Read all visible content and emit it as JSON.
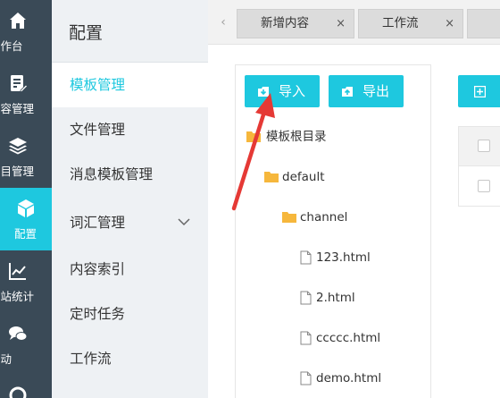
{
  "rail": {
    "items": [
      {
        "label": "工作台",
        "icon": "home-icon"
      },
      {
        "label": "内容管理",
        "icon": "document-edit-icon"
      },
      {
        "label": "栏目管理",
        "icon": "layers-icon"
      },
      {
        "label": "配置",
        "icon": "cube-icon",
        "active": true
      },
      {
        "label": "网站统计",
        "icon": "line-chart-icon"
      },
      {
        "label": "互动",
        "icon": "chat-icon"
      }
    ]
  },
  "submenu": {
    "title": "配置",
    "items": [
      {
        "label": "模板管理",
        "active": true
      },
      {
        "label": "文件管理"
      },
      {
        "label": "消息模板管理"
      },
      {
        "label": "词汇管理",
        "has_children": true
      },
      {
        "label": "内容索引"
      },
      {
        "label": "定时任务"
      },
      {
        "label": "工作流"
      }
    ]
  },
  "tabs": [
    {
      "label": "新增内容"
    },
    {
      "label": "工作流"
    }
  ],
  "toolbar": {
    "import_label": "导入",
    "export_label": "导出"
  },
  "tree": {
    "root": "模板根目录",
    "folder_default": "default",
    "folder_channel": "channel",
    "files": [
      "123.html",
      "2.html",
      "ccccc.html",
      "demo.html"
    ]
  },
  "colors": {
    "accent": "#1ec8df",
    "rail_bg": "#3a4a57",
    "folder": "#f6b73c",
    "annotation": "#e53935"
  }
}
